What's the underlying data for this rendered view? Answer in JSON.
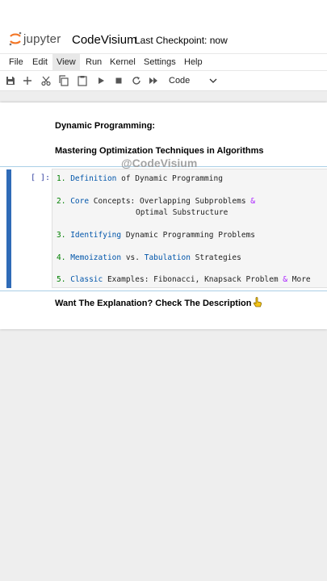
{
  "app": {
    "logo_text": "jupyter",
    "notebook_title": "CodeVisium",
    "checkpoint": "Last Checkpoint: now"
  },
  "menu": [
    "File",
    "Edit",
    "View",
    "Run",
    "Kernel",
    "Settings",
    "Help"
  ],
  "menu_active": "View",
  "toolbar": {
    "icons": [
      "save-icon",
      "add-icon",
      "cut-icon",
      "copy-icon",
      "paste-icon",
      "run-icon",
      "stop-icon",
      "restart-icon",
      "fast-forward-icon"
    ],
    "cell_type": "Code"
  },
  "cells": {
    "md_title": "Dynamic Programming:",
    "md_subtitle": "Mastering Optimization Techniques in Algorithms",
    "prompt": "[ ]:",
    "code": {
      "l1": {
        "num": "1.",
        "kw": "Definition",
        "rest": " of Dynamic Programming"
      },
      "l2": {
        "num": "2.",
        "kw": "Core",
        "rest": " Concepts: Overlapping Subproblems ",
        "amp": "&"
      },
      "l2b": "Optimal Substructure",
      "l3": {
        "num": "3.",
        "kw": "Identifying",
        "rest": " Dynamic Programming Problems"
      },
      "l4": {
        "num": "4.",
        "kw": "Memoization",
        "mid": " vs. ",
        "kw2": "Tabulation",
        "rest": " Strategies"
      },
      "l5": {
        "num": "5.",
        "kw": "Classic",
        "rest": " Examples: Fibonacci, Knapsack Problem ",
        "amp": "&",
        "tail": " More"
      }
    },
    "md_footer": "Want The Explanation? Check The Description"
  },
  "watermark": "@CodeVisium",
  "colors": {
    "accent_bar": "#2f6bb7",
    "number": "#008000",
    "keyword": "#0055aa",
    "operator": "#aa22ff",
    "jupyter_orange": "#f37626"
  }
}
